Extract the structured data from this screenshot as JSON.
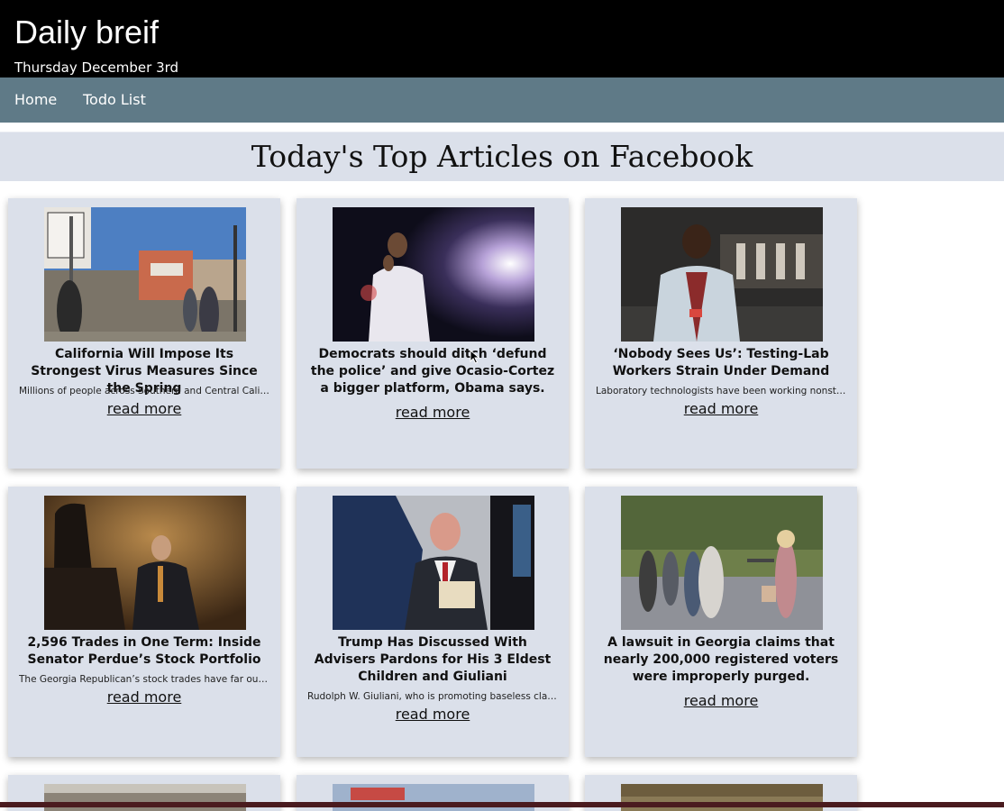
{
  "header": {
    "title": "Daily breif",
    "date": "Thursday December 3rd"
  },
  "nav": {
    "items": [
      {
        "label": "Home"
      },
      {
        "label": "Todo List"
      }
    ]
  },
  "section": {
    "title": "Today's Top Articles on Facebook"
  },
  "articles": [
    {
      "title": "California Will Impose Its Strongest Virus Measures Since the Spring",
      "description": "Millions of people across Southern and Central California will be under strict new stay-at-home orders",
      "link_label": "read more"
    },
    {
      "title": "Democrats should ditch ‘defund the police’ and give Ocasio-Cortez a bigger platform, Obama says.",
      "description": "",
      "link_label": "read more"
    },
    {
      "title": "‘Nobody Sees Us’: Testing-Lab Workers Strain Under Demand",
      "description": "Laboratory technologists have been working nonstop to process coronavirus tests",
      "link_label": "read more"
    },
    {
      "title": "2,596 Trades in One Term: Inside Senator Perdue’s Stock Portfolio",
      "description": "The Georgia Republican’s stock trades have far outpaced those of his colleagues",
      "link_label": "read more"
    },
    {
      "title": "Trump Has Discussed With Advisers Pardons for His 3 Eldest Children and Giuliani",
      "description": "Rudolph W. Giuliani, who is promoting baseless claims of election fraud",
      "link_label": "read more"
    },
    {
      "title": "A lawsuit in Georgia claims that nearly 200,000 registered voters were improperly purged.",
      "description": "",
      "link_label": "read more"
    }
  ],
  "colors": {
    "header_bg": "#000000",
    "nav_bg": "#5f7a87",
    "card_bg": "#dbe0ea"
  }
}
